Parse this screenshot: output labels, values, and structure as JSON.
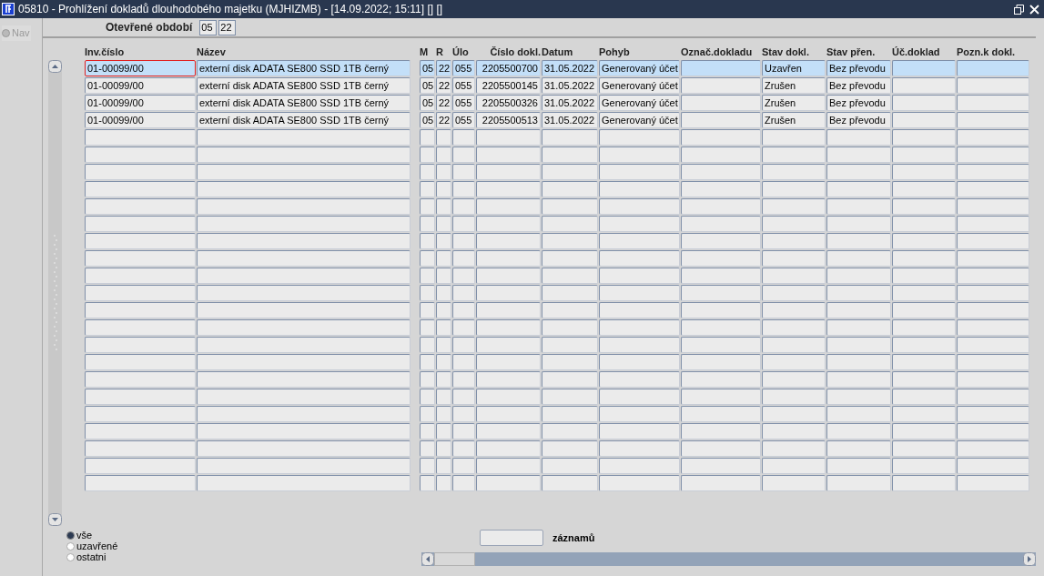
{
  "window": {
    "title": "05810 - Prohlížení dokladů dlouhodobého majetku (MJHIZMB) - [14.09.2022; 15:11] [] []"
  },
  "nav": {
    "label": "Nav",
    "selected": false
  },
  "period": {
    "label": "Otevřené období",
    "month": "05",
    "year": "22"
  },
  "table": {
    "columns": [
      "Inv.číslo",
      "Název",
      "M",
      "R",
      "Úlo",
      "Číslo dokl.",
      "Datum",
      "Pohyb",
      "Označ.dokladu",
      "Stav dokl.",
      "Stav přen.",
      "Úč.doklad",
      "Pozn.k dokl."
    ],
    "rows": [
      {
        "selected": true,
        "cells": [
          "01-00099/00",
          "externí disk ADATA SE800 SSD 1TB černý",
          "05",
          "22",
          "055",
          "2205500700",
          "31.05.2022",
          "Generovaný účet",
          "",
          "Uzavřen",
          "Bez převodu",
          "",
          ""
        ]
      },
      {
        "selected": false,
        "cells": [
          "01-00099/00",
          "externí disk ADATA SE800 SSD 1TB černý",
          "05",
          "22",
          "055",
          "2205500145",
          "31.05.2022",
          "Generovaný účet",
          "",
          "Zrušen",
          "Bez převodu",
          "",
          ""
        ]
      },
      {
        "selected": false,
        "cells": [
          "01-00099/00",
          "externí disk ADATA SE800 SSD 1TB černý",
          "05",
          "22",
          "055",
          "2205500326",
          "31.05.2022",
          "Generovaný účet",
          "",
          "Zrušen",
          "Bez převodu",
          "",
          ""
        ]
      },
      {
        "selected": false,
        "cells": [
          "01-00099/00",
          "externí disk ADATA SE800 SSD 1TB černý",
          "05",
          "22",
          "055",
          "2205500513",
          "31.05.2022",
          "Generovaný účet",
          "",
          "Zrušen",
          "Bez převodu",
          "",
          ""
        ]
      }
    ]
  },
  "filter": [
    {
      "label": "vše",
      "selected": true
    },
    {
      "label": "uzavřené",
      "selected": false
    },
    {
      "label": "ostatni",
      "selected": false
    }
  ],
  "records": {
    "label": "záznamů"
  }
}
